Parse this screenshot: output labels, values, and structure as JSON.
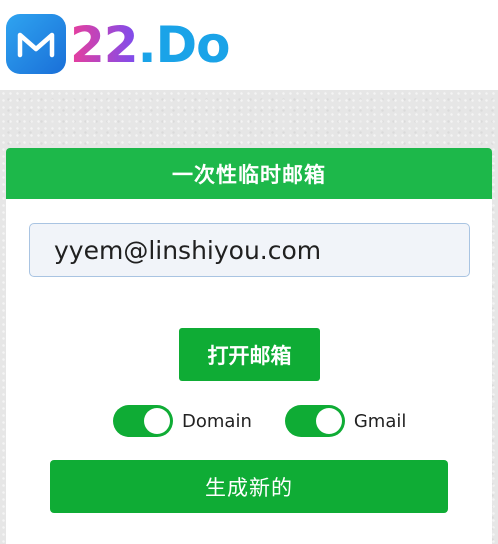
{
  "brand": {
    "num": "22",
    "dot": ".",
    "do": "Do",
    "colors": {
      "pink": "#e93e9b",
      "purple": "#7a4df0",
      "blue": "#1aa3e8"
    }
  },
  "card": {
    "title": "一次性临时邮箱",
    "email": {
      "value": "yyem@linshiyou.com",
      "placeholder": ""
    },
    "open_label": "打开邮箱",
    "toggles": [
      {
        "label": "Domain",
        "on": true
      },
      {
        "label": "Gmail",
        "on": true
      }
    ],
    "generate_label": "生成新的"
  },
  "colors": {
    "accent": "#1db84a",
    "button": "#0fac35"
  },
  "icons": {
    "logo": "mail-m-logo-icon"
  }
}
